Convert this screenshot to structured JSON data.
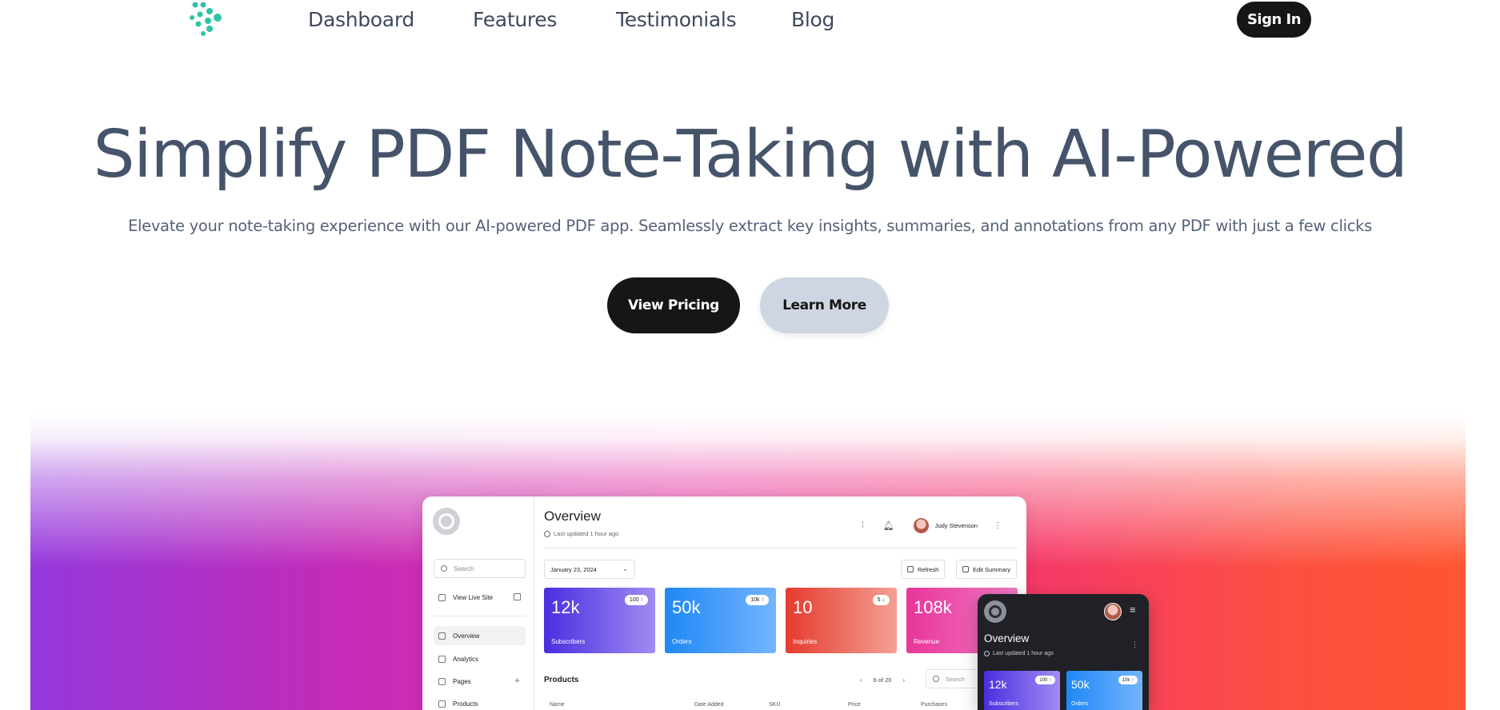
{
  "nav": {
    "links": [
      "Dashboard",
      "Features",
      "Testimonials",
      "Blog"
    ],
    "sign_in": "Sign In"
  },
  "hero": {
    "title": "Simplify PDF Note-Taking with AI-Powered",
    "subtitle": "Elevate your note-taking experience with our AI-powered PDF app. Seamlessly extract key insights, summaries, and annotations from any PDF with just a few clicks",
    "primary_button": "View Pricing",
    "secondary_button": "Learn More"
  },
  "colors": {
    "brand_teal": "#2ec4a7",
    "dark": "#161616",
    "text": "#45546a",
    "secondary_button_bg": "#cfd6e3"
  },
  "desktop_mockup": {
    "sidebar": {
      "search_placeholder": "Search",
      "view_live_site": "View Live Site",
      "items": [
        "Overview",
        "Analytics",
        "Pages",
        "Products"
      ]
    },
    "title": "Overview",
    "updated": "Last updated 1 hour ago",
    "user_name": "Judy Stevenson",
    "date": "January 23, 2024",
    "refresh": "Refresh",
    "edit_summary": "Edit Summary",
    "cards": [
      {
        "value": "12k",
        "label": "Subscribers",
        "badge": "100 ↑"
      },
      {
        "value": "50k",
        "label": "Orders",
        "badge": "10k ↑"
      },
      {
        "value": "10",
        "label": "Inquiries",
        "badge": "5 ↓"
      },
      {
        "value": "108k",
        "label": "Revenue",
        "badge": ""
      }
    ],
    "products": {
      "title": "Products",
      "pager": "6 of 20",
      "search_placeholder": "Search",
      "columns": [
        "Name",
        "Date Added",
        "SKU",
        "Price",
        "Purchases"
      ]
    }
  },
  "mobile_mockup": {
    "title": "Overview",
    "updated": "Last updated 1 hour ago",
    "cards": [
      {
        "value": "12k",
        "label": "Subscribers",
        "badge": "100 ↑"
      },
      {
        "value": "50k",
        "label": "Orders",
        "badge": "10k ↑"
      }
    ]
  }
}
